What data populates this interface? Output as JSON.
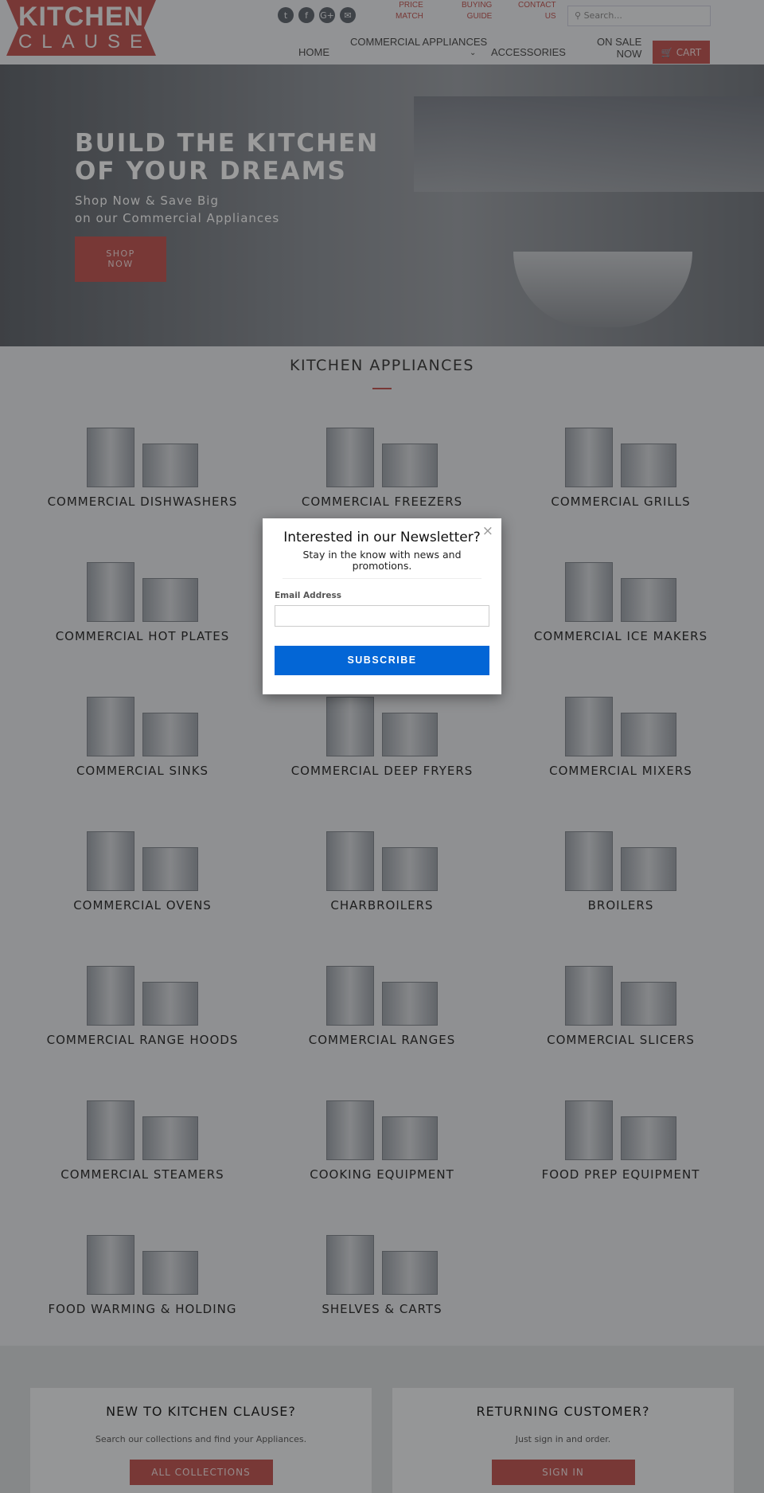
{
  "header": {
    "logo_line1": "KITCHEN",
    "logo_line2": "CLAUSE",
    "social": [
      {
        "icon": "twitter-icon",
        "glyph": "t"
      },
      {
        "icon": "facebook-icon",
        "glyph": "f"
      },
      {
        "icon": "google-plus-icon",
        "glyph": "G+"
      },
      {
        "icon": "email-icon",
        "glyph": "✉"
      }
    ],
    "top_links": [
      {
        "l1": "PRICE",
        "l2": "MATCH"
      },
      {
        "l1": "BUYING",
        "l2": "GUIDE"
      },
      {
        "l1": "CONTACT",
        "l2": "US"
      }
    ],
    "search_placeholder": "Search...",
    "nav": {
      "home": "HOME",
      "appliances": "COMMERCIAL APPLIANCES",
      "accessories": "ACCESSORIES",
      "sale1": "ON SALE",
      "sale2": "NOW",
      "cart": "CART"
    }
  },
  "hero": {
    "title1": "BUILD THE KITCHEN",
    "title2": "OF YOUR DREAMS",
    "sub1": "Shop Now & Save Big",
    "sub2": "on our Commercial Appliances",
    "btn1": "SHOP",
    "btn2": "NOW"
  },
  "section_title": "KITCHEN APPLIANCES",
  "categories": [
    "COMMERCIAL DISHWASHERS",
    "COMMERCIAL FREEZERS",
    "COMMERCIAL GRILLS",
    "COMMERCIAL HOT PLATES",
    "",
    "COMMERCIAL ICE MAKERS",
    "COMMERCIAL SINKS",
    "COMMERCIAL DEEP FRYERS",
    "COMMERCIAL MIXERS",
    "COMMERCIAL OVENS",
    "CHARBROILERS",
    "BROILERS",
    "COMMERCIAL RANGE HOODS",
    "COMMERCIAL RANGES",
    "COMMERCIAL SLICERS",
    "COMMERCIAL STEAMERS",
    "COOKING EQUIPMENT",
    "FOOD PREP EQUIPMENT",
    "FOOD WARMING & HOLDING",
    "SHELVES & CARTS"
  ],
  "bottom": {
    "new_title": "NEW TO KITCHEN CLAUSE?",
    "new_text": "Search our collections and find your Appliances.",
    "new_btn": "ALL COLLECTIONS",
    "ret_title": "RETURNING CUSTOMER?",
    "ret_text": "Just sign in and order.",
    "ret_btn": "SIGN IN"
  },
  "modal": {
    "title": "Interested in our Newsletter?",
    "subtitle": "Stay in the know with news and promotions.",
    "email_label": "Email Address",
    "email_value": "",
    "submit": "SUBSCRIBE",
    "close": "×"
  },
  "colors": {
    "brand_red": "#c0504d",
    "subscribe_blue": "#0366d6"
  }
}
